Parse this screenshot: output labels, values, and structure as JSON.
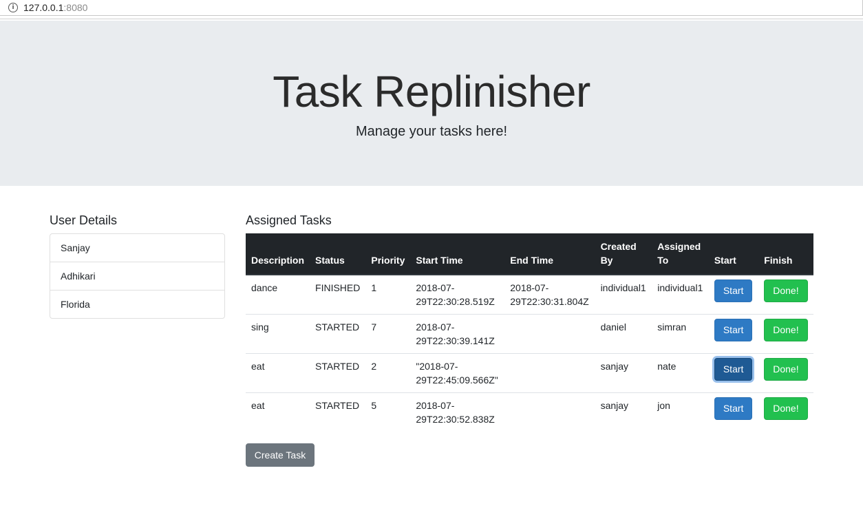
{
  "browser": {
    "url_host": "127.0.0.1",
    "url_port": ":8080",
    "info_icon": "info-icon"
  },
  "jumbotron": {
    "title": "Task Replinisher",
    "lead": "Manage your tasks here!"
  },
  "user_details": {
    "title": "User Details",
    "items": [
      "Sanjay",
      "Adhikari",
      "Florida"
    ]
  },
  "tasks": {
    "title": "Assigned Tasks",
    "headers": [
      "Description",
      "Status",
      "Priority",
      "Start Time",
      "End Time",
      "Created By",
      "Assigned To",
      "Start",
      "Finish"
    ],
    "rows": [
      {
        "description": "dance",
        "status": "FINISHED",
        "priority": "1",
        "start_time": "2018-07-29T22:30:28.519Z",
        "end_time": "2018-07-29T22:30:31.804Z",
        "created_by": "individual1",
        "assigned_to": "individual1",
        "start_label": "Start",
        "done_label": "Done!"
      },
      {
        "description": "sing",
        "status": "STARTED",
        "priority": "7",
        "start_time": "2018-07-29T22:30:39.141Z",
        "end_time": "",
        "created_by": "daniel",
        "assigned_to": "simran",
        "start_label": "Start",
        "done_label": "Done!"
      },
      {
        "description": "eat",
        "status": "STARTED",
        "priority": "2",
        "start_time": "\"2018-07-29T22:45:09.566Z\"",
        "end_time": "",
        "created_by": "sanjay",
        "assigned_to": "nate",
        "start_label": "Start",
        "done_label": "Done!"
      },
      {
        "description": "eat",
        "status": "STARTED",
        "priority": "5",
        "start_time": "2018-07-29T22:30:52.838Z",
        "end_time": "",
        "created_by": "sanjay",
        "assigned_to": "jon",
        "start_label": "Start",
        "done_label": "Done!"
      }
    ],
    "create_label": "Create Task"
  },
  "colors": {
    "jumbotron_bg": "#e9ecef",
    "table_header_bg": "#212529",
    "primary": "#2e7ac4",
    "success": "#22c04f",
    "secondary": "#6c757d"
  }
}
